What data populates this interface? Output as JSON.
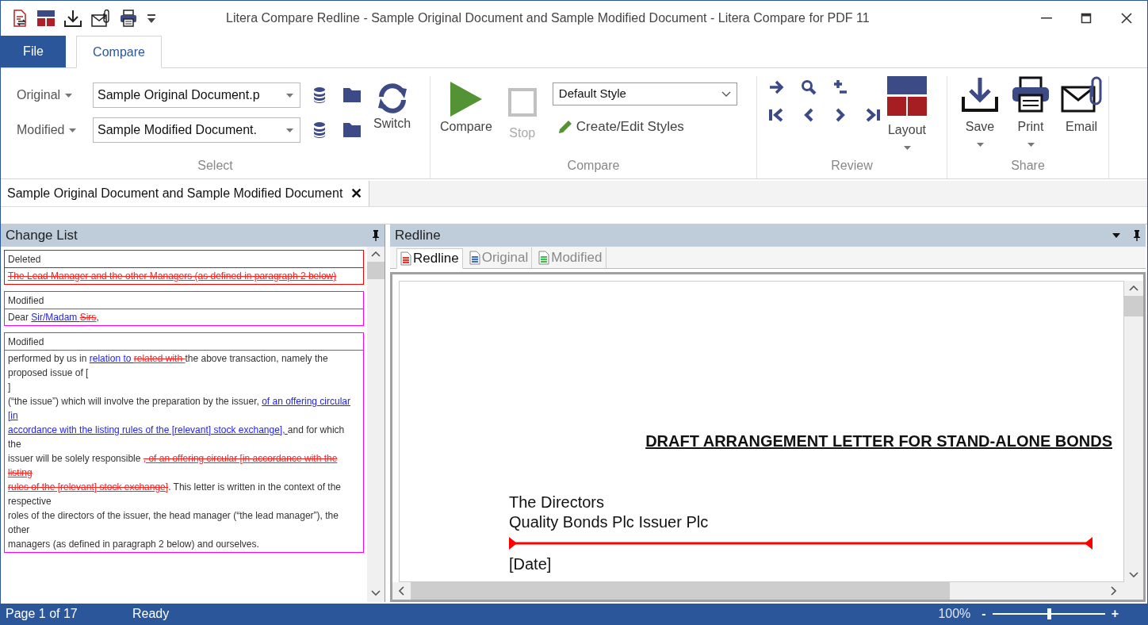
{
  "window": {
    "title": "Litera Compare Redline - Sample Original Document and Sample Modified Document - Litera Compare for PDF 11"
  },
  "ribbon_tabs": [
    {
      "label": "File",
      "kind": "file",
      "selected": false
    },
    {
      "label": "Compare",
      "kind": "tab",
      "selected": true
    }
  ],
  "select_group": {
    "label": "Select",
    "rows": [
      {
        "label": "Original",
        "value": "Sample Original Document.p"
      },
      {
        "label": "Modified",
        "value": "Sample Modified Document."
      }
    ],
    "switch": "Switch"
  },
  "compare_group": {
    "label": "Compare",
    "buttons": [
      {
        "label": "Compare",
        "kind": "play",
        "disabled": false
      },
      {
        "label": "Stop",
        "kind": "stop",
        "disabled": true
      }
    ],
    "style": "Default Style",
    "styles_button": "Create/Edit Styles"
  },
  "review_group": {
    "label": "Review",
    "layout": "Layout"
  },
  "share_group": {
    "label": "Share",
    "buttons": [
      {
        "label": "Save",
        "kind": "save",
        "dropdown": true
      },
      {
        "label": "Print",
        "kind": "print",
        "dropdown": true
      },
      {
        "label": "Email",
        "kind": "email",
        "dropdown": false
      }
    ]
  },
  "document_tab": {
    "label": "Sample Original Document and Sample Modified Document",
    "close": "✕"
  },
  "change_list": {
    "title": "Change List",
    "changes": [
      {
        "type": "Deleted",
        "color": "#ff0000",
        "lines": [
          [
            {
              "kind": "deleted",
              "text": "The Lead Manager and the other Managers (as defined in paragraph 2 below)"
            }
          ]
        ]
      },
      {
        "type": "Modified",
        "color": "#ff00ff",
        "lines": [
          [
            {
              "kind": "plain",
              "text": "Dear "
            },
            {
              "kind": "inserted",
              "text": "Sir/Madam "
            },
            {
              "kind": "deleted",
              "text": "Sirs"
            },
            {
              "kind": "plain",
              "text": ","
            }
          ]
        ]
      },
      {
        "type": "Modified",
        "color": "#ff00ff",
        "lines": [
          [
            {
              "kind": "plain",
              "text": "performed by us in "
            },
            {
              "kind": "inserted",
              "text": "relation to "
            },
            {
              "kind": "deleted",
              "text": "related with "
            },
            {
              "kind": "plain",
              "text": "the above transaction, namely the proposed issue of ["
            }
          ],
          [
            {
              "kind": "plain",
              "text": "]"
            }
          ],
          [
            {
              "kind": "plain",
              "text": "(“the issue”) which will involve the preparation by the issuer,  "
            },
            {
              "kind": "inserted",
              "text": "of an offering circular [in"
            }
          ],
          [
            {
              "kind": "inserted",
              "text": "accordance with the listing rules of the [relevant] stock exchange], "
            },
            {
              "kind": "plain",
              "text": "and for which the"
            }
          ],
          [
            {
              "kind": "plain",
              "text": "issuer will be solely responsible "
            },
            {
              "kind": "deleted",
              "text": ", of an offering circular [in accordance with the listing"
            }
          ],
          [
            {
              "kind": "deleted",
              "text": "rules of the [relevant] stock exchange]"
            },
            {
              "kind": "plain",
              "text": ". This letter is written in the context of the"
            }
          ],
          [
            {
              "kind": "plain",
              "text": "respective"
            }
          ],
          [
            {
              "kind": "plain",
              "text": "roles of the directors of the issuer, the head manager (“the lead manager”), the other"
            }
          ],
          [
            {
              "kind": "plain",
              "text": "managers (as defined in paragraph 2 below) and ourselves."
            }
          ]
        ]
      }
    ]
  },
  "redline": {
    "title": "Redline",
    "view_tabs": [
      {
        "label": "Redline",
        "color": "#e53935",
        "selected": true
      },
      {
        "label": "Original",
        "color": "#3f6fc9",
        "selected": false
      },
      {
        "label": "Modified",
        "color": "#3fbf4a",
        "selected": false
      }
    ],
    "document": {
      "heading": "DRAFT ARRANGEMENT LETTER FOR STAND-ALONE BONDS",
      "lines": [
        "The Directors",
        "Quality Bonds Plc Issuer Plc"
      ],
      "date": "[Date]"
    }
  },
  "status_bar": {
    "page": "Page 1 of 17",
    "state": "Ready",
    "zoom": "100%",
    "zoom_minus": "-",
    "zoom_plus": "+",
    "zoom_level": {
      "level": 0.5
    }
  }
}
